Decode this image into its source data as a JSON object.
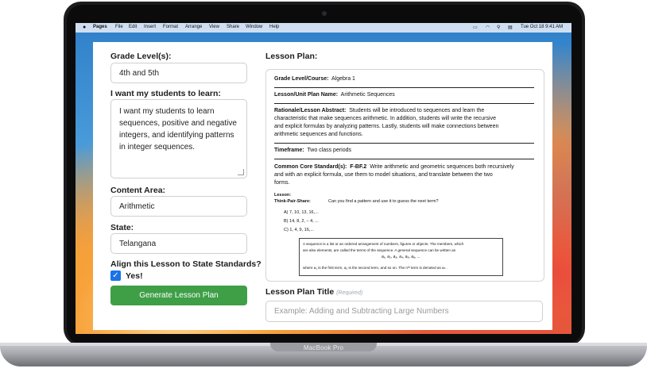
{
  "menubar": {
    "items": [
      "Pages",
      "File",
      "Edit",
      "Insert",
      "Format",
      "Arrange",
      "View",
      "Share",
      "Window",
      "Help"
    ],
    "clock": "Tue Oct 18  9:41 AM"
  },
  "device": {
    "label": "MacBook Pro"
  },
  "form": {
    "grade_label": "Grade Level(s):",
    "grade_value": "4th and 5th",
    "learn_label": "I want my students to learn:",
    "learn_value": "I want my students to learn sequences, positive and negative integers, and identifying patterns in integer sequences.",
    "content_label": "Content Area:",
    "content_value": "Arithmetic",
    "state_label": "State:",
    "state_value": "Telangana",
    "align_label": "Align this Lesson to State Standards?",
    "checkbox_label": "Yes!",
    "checkbox_checked": true,
    "generate_button": "Generate Lesson Plan"
  },
  "lesson_plan": {
    "heading": "Lesson Plan:",
    "grade_course_label": "Grade Level/Course:",
    "grade_course_value": "Algebra 1",
    "unit_label": "Lesson/Unit Plan Name:",
    "unit_value": "Arithmetic Sequences",
    "rationale_label": "Rationale/Lesson Abstract:",
    "rationale_line1": "Students will be introduced to sequences and learn the",
    "rationale_line2": "characteristic that make sequences arithmetic.  In addition, students will write the recursive",
    "rationale_line3": "and explicit formulas by analyzing patterns.  Lastly, students will make connections between",
    "rationale_line4": "arithmetic sequences and functions.",
    "timeframe_label": "Timeframe:",
    "timeframe_value": "Two class periods",
    "ccs_label": "Common Core Standard(s):",
    "ccs_code": "F-BF.2",
    "ccs_line1": "Write arithmetic and geometric sequences both recursively",
    "ccs_line2": "and with an explicit formula, use them to model situations, and translate between the two",
    "ccs_line3": "forms.",
    "lesson_label": "Lesson:",
    "tps_label": "Think-Pair-Share:",
    "tps_question": "Can you find a pattern and use it to guess the next term?",
    "options": [
      "A)    7, 10, 13, 16,...",
      "B)    14, 8, 2, − 4, ...",
      "C)    1, 4, 9, 16,..."
    ],
    "def_line1": "A sequence is a list or an ordered arrangement of numbers, figures or objects.  The members, which",
    "def_line2": "are also elements, are called the terms of the sequence.  A general sequence can be written as",
    "def_formula": "a₁, a₂, a₃, a₄, a₅, a₆, ...",
    "def_line3": "where  a₁ is the first term,  a₂ is the second term, and so on.  The nᵗʰ term is denoted as  aₙ ."
  },
  "title_field": {
    "label": "Lesson Plan Title",
    "required": "(Required)",
    "placeholder": "Example: Adding and Subtracting Large Numbers"
  }
}
